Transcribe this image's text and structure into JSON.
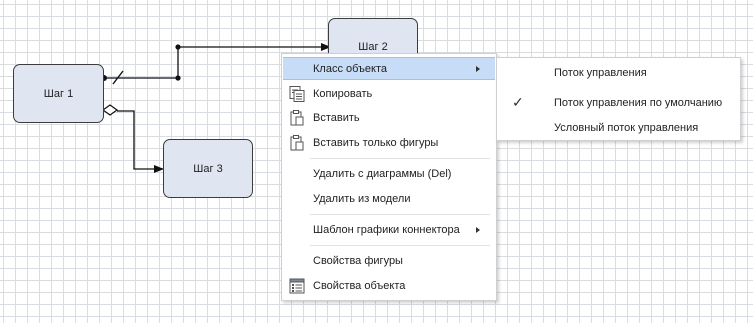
{
  "diagram": {
    "nodes": [
      {
        "label": "Шаг 1"
      },
      {
        "label": "Шаг 2"
      },
      {
        "label": "Шаг 3"
      }
    ]
  },
  "context_menu": {
    "items": [
      {
        "label": "Класс объекта",
        "has_submenu": true,
        "highlighted": true
      },
      {
        "label": "Копировать",
        "icon": "copy-icon"
      },
      {
        "label": "Вставить",
        "icon": "paste-icon"
      },
      {
        "label": "Вставить только фигуры",
        "icon": "paste-shapes-icon"
      },
      {
        "label": "Удалить с диаграммы (Del)"
      },
      {
        "label": "Удалить из модели"
      },
      {
        "label": "Шаблон графики коннектора",
        "has_submenu": true
      },
      {
        "label": "Свойства фигуры"
      },
      {
        "label": "Свойства объекта",
        "icon": "properties-icon"
      }
    ]
  },
  "submenu": {
    "items": [
      {
        "label": "Поток управления",
        "checked": false
      },
      {
        "label": "Поток управления по умолчанию",
        "checked": true
      },
      {
        "label": "Условный поток управления",
        "checked": false
      }
    ]
  },
  "colors": {
    "node_fill": "#dfe6f2",
    "menu_highlight": "#c7dcf6",
    "grid_line": "#d9dde2"
  }
}
